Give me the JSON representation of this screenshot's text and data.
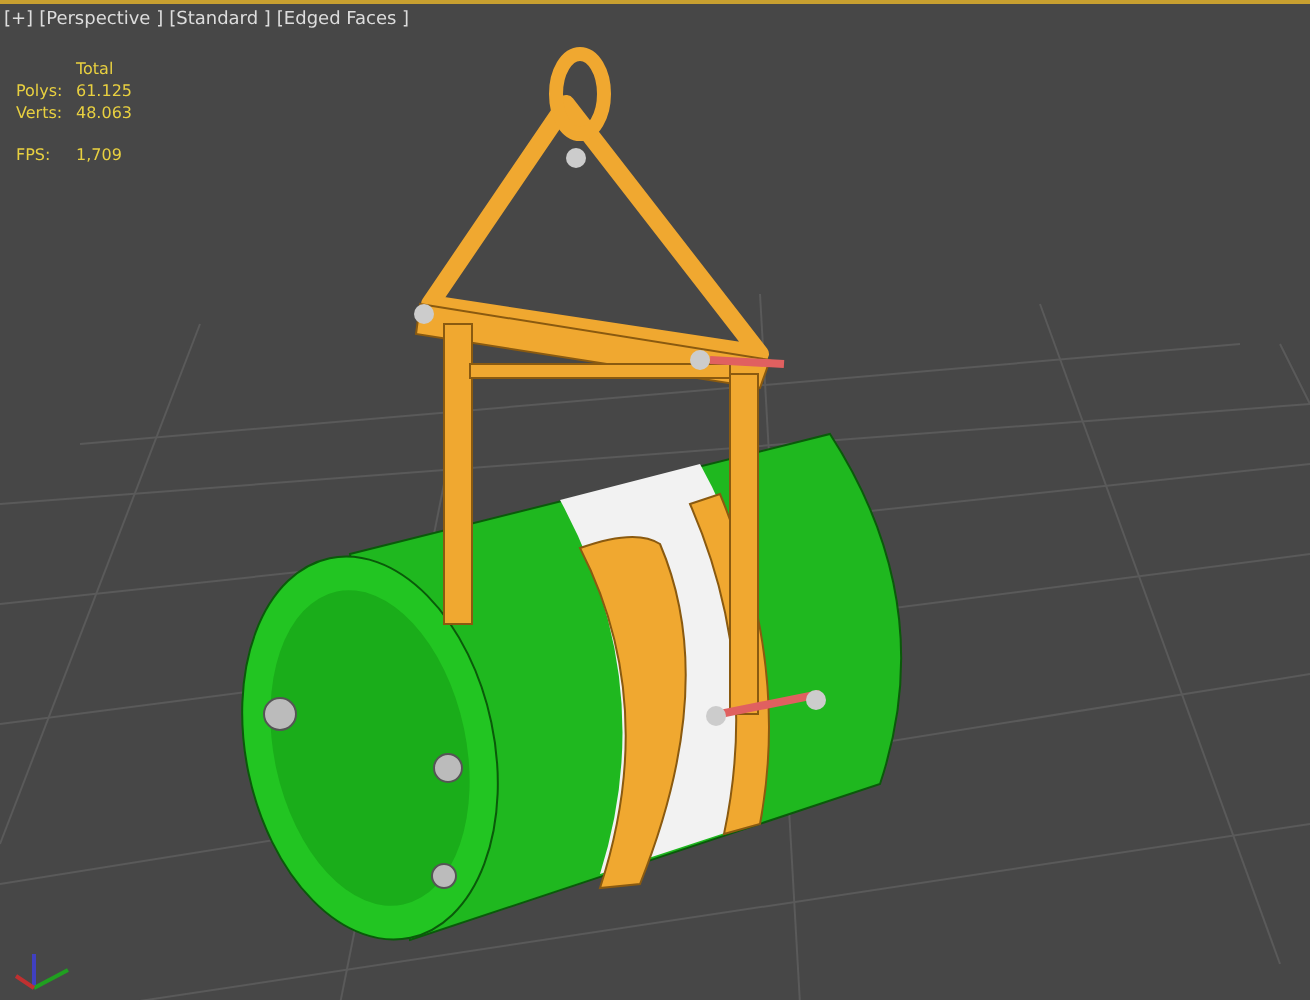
{
  "viewport_labels": [
    "[+]",
    "[Perspective ]",
    "[Standard ]",
    "[Edged Faces ]"
  ],
  "statistics": {
    "header": "Total",
    "rows": [
      {
        "label": "Polys:",
        "value": "61.125"
      },
      {
        "label": "Verts:",
        "value": "48.063"
      }
    ],
    "fps": {
      "label": "FPS:",
      "value": "1,709"
    }
  }
}
